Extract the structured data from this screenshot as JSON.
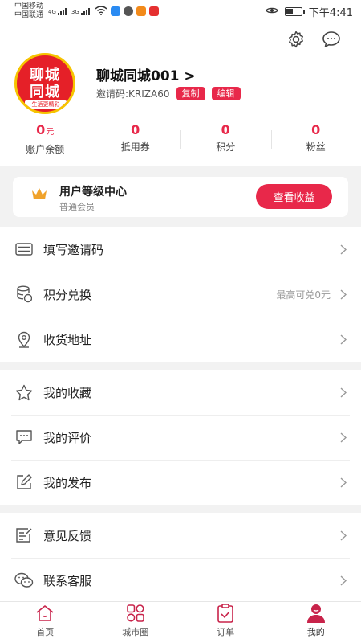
{
  "status_bar": {
    "carrier_1": "中国移动",
    "carrier_2": "中国联通",
    "net_1": "4G",
    "net_2": "3G",
    "time": "下午4:41"
  },
  "header": {
    "logo_line_1": "聊城",
    "logo_line_2": "同城",
    "logo_tagline": "生活更精彩",
    "user_name": "聊城同城001 >",
    "invite_code_label": "邀请码:KRIZA60",
    "copy_label": "复制",
    "edit_label": "编辑",
    "stats": [
      {
        "value": "0",
        "unit": "元",
        "label": "账户余额"
      },
      {
        "value": "0",
        "unit": "",
        "label": "抵用券"
      },
      {
        "value": "0",
        "unit": "",
        "label": "积分"
      },
      {
        "value": "0",
        "unit": "",
        "label": "粉丝"
      }
    ]
  },
  "level_card": {
    "title": "用户等级中心",
    "subtitle": "普通会员",
    "button_label": "查看收益"
  },
  "menu_group_1": [
    {
      "label": "填写邀请码",
      "icon": "ticket-icon",
      "hint": ""
    },
    {
      "label": "积分兑换",
      "icon": "coins-icon",
      "hint": "最高可兑0元"
    },
    {
      "label": "收货地址",
      "icon": "location-icon",
      "hint": ""
    }
  ],
  "menu_group_2": [
    {
      "label": "我的收藏",
      "icon": "star-icon"
    },
    {
      "label": "我的评价",
      "icon": "comment-icon"
    },
    {
      "label": "我的发布",
      "icon": "edit-icon"
    }
  ],
  "menu_group_3": [
    {
      "label": "意见反馈",
      "icon": "feedback-icon"
    },
    {
      "label": "联系客服",
      "icon": "wechat-icon"
    }
  ],
  "tabbar": [
    {
      "label": "首页",
      "icon": "home-icon"
    },
    {
      "label": "城市圈",
      "icon": "grid-icon"
    },
    {
      "label": "订单",
      "icon": "clipboard-icon"
    },
    {
      "label": "我的",
      "icon": "user-icon",
      "active": true
    }
  ],
  "colors": {
    "accent": "#e8284a",
    "page_bg": "#f2f2f2",
    "logo_red": "#e52028",
    "logo_yellow": "#f6c400",
    "crown_orange": "#f0a22a"
  }
}
